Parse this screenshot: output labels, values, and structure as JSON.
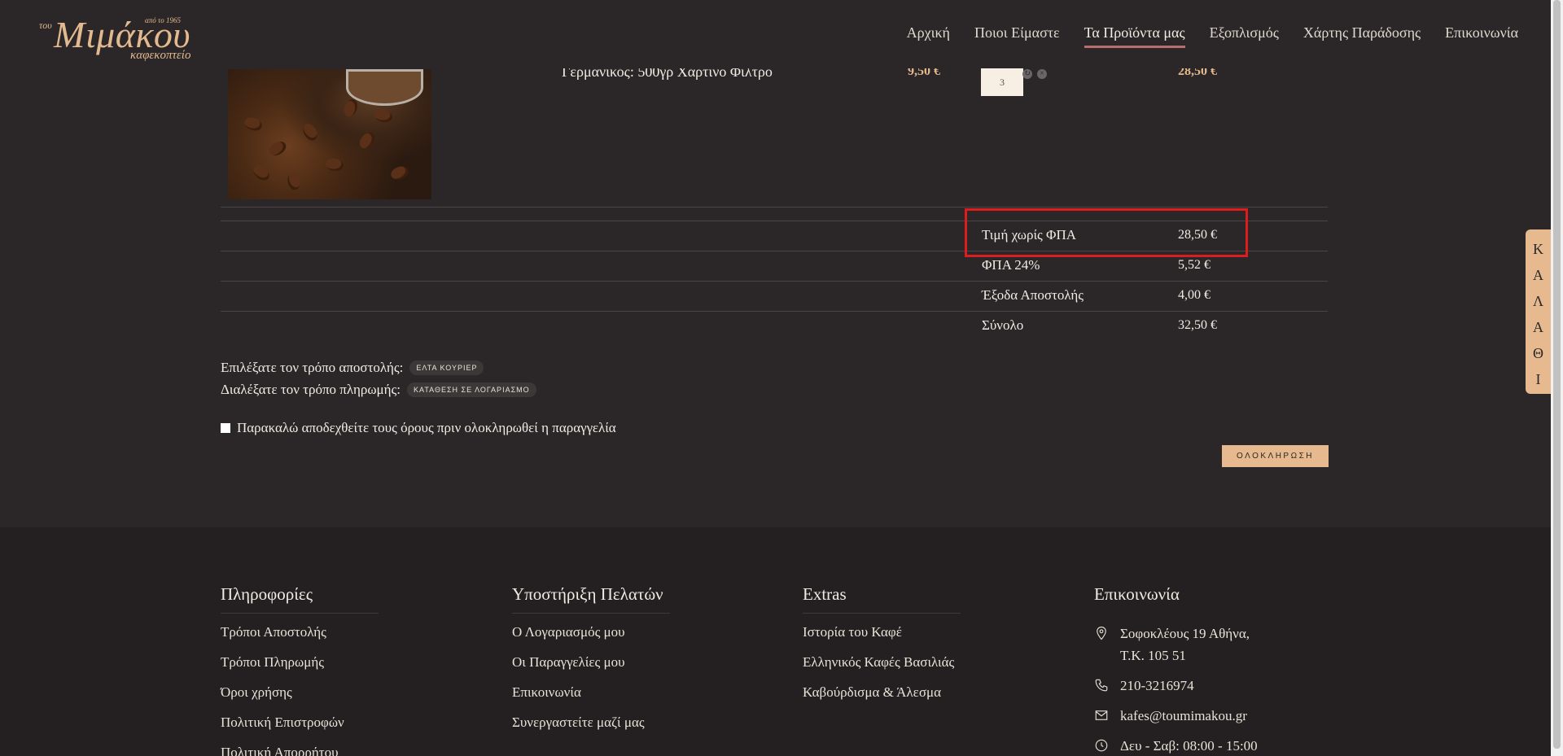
{
  "logo": {
    "prefix": "του",
    "since": "από το 1965",
    "name": "Μιμάκου",
    "subtitle": "καφεκοπτείο"
  },
  "nav": [
    "Αρχική",
    "Ποιοι Είμαστε",
    "Τα Προϊόντα μας",
    "Εξοπλισμός",
    "Χάρτης Παράδοσης",
    "Επικοινωνία"
  ],
  "nav_active_index": 2,
  "cart": {
    "item": {
      "name": "Γερμανικός: 500γρ Χάρτινο Φίλτρο",
      "unit_price": "9,50 €",
      "quantity": "3",
      "total": "28,50 €"
    },
    "summary": [
      {
        "label": "Τιμή χωρίς ΦΠΑ",
        "value": "28,50 €"
      },
      {
        "label": "ΦΠΑ 24%",
        "value": "5,52 €"
      },
      {
        "label": "Έξοδα Αποστολής",
        "value": "4,00 €"
      },
      {
        "label": "Σύνολο",
        "value": "32,50 €"
      }
    ],
    "shipping_label": "Επιλέξατε τον τρόπο αποστολής:",
    "shipping_value": "ΕΛΤΑ ΚΟΥΡΙΕΡ",
    "payment_label": "Διαλέξατε τον τρόπο πληρωμής:",
    "payment_value": "ΚΑΤΑΘΕΣΗ ΣΕ ΛΟΓΑΡΙΑΣΜΟ",
    "terms_text": "Παρακαλώ αποδεχθείτε τους όρους πριν ολοκληρωθεί η παραγγελία",
    "complete_label": "ΟΛΟΚΛΗΡΩΣΗ"
  },
  "side_tab": [
    "Κ",
    "Α",
    "Λ",
    "Α",
    "Θ",
    "Ι"
  ],
  "footer": {
    "info": {
      "title": "Πληροφορίες",
      "links": [
        "Τρόποι Αποστολής",
        "Τρόποι Πληρωμής",
        "Όροι χρήσης",
        "Πολιτική Επιστροφών",
        "Πολιτική Απορρήτου"
      ]
    },
    "support": {
      "title": "Υποστήριξη Πελατών",
      "links": [
        "Ο Λογαριασμός μου",
        "Οι Παραγγελίες μου",
        "Επικοινωνία",
        "Συνεργαστείτε μαζί μας"
      ]
    },
    "extras": {
      "title": "Extras",
      "links": [
        "Ιστορία του Καφέ",
        "Ελληνικός Καφές Βασιλιάς",
        "Καβούρδισμα & Άλεσμα"
      ]
    },
    "contact": {
      "title": "Επικοινωνία",
      "address_line1": "Σοφοκλέους 19 Αθήνα,",
      "address_line2": "Τ.Κ. 105 51",
      "phone": "210-3216974",
      "email": "kafes@toumimakou.gr",
      "hours": "Δευ - Σαβ: 08:00 - 15:00"
    }
  }
}
